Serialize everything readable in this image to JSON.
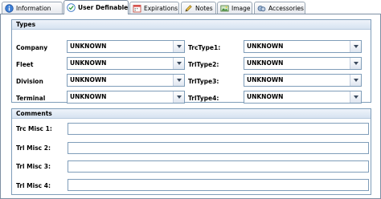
{
  "tabs": [
    {
      "label": "Information",
      "icon": "info-icon"
    },
    {
      "label": "User Definables",
      "icon": "user-definables-icon",
      "active": true
    },
    {
      "label": "Expirations",
      "icon": "calendar-icon"
    },
    {
      "label": "Notes",
      "icon": "pencil-icon"
    },
    {
      "label": "Image",
      "icon": "image-icon"
    },
    {
      "label": "Accessories",
      "icon": "accessories-icon"
    }
  ],
  "types": {
    "title": "Types",
    "fields": [
      {
        "label": "Company",
        "value": "UNKNOWN"
      },
      {
        "label": "Fleet",
        "value": "UNKNOWN"
      },
      {
        "label": "Division",
        "value": "UNKNOWN"
      },
      {
        "label": "Terminal",
        "value": "UNKNOWN"
      },
      {
        "label": "TrcType1:",
        "value": "UNKNOWN"
      },
      {
        "label": "TrlType2:",
        "value": "UNKNOWN"
      },
      {
        "label": "TrlType3:",
        "value": "UNKNOWN"
      },
      {
        "label": "TrlType4:",
        "value": "UNKNOWN"
      }
    ]
  },
  "comments": {
    "title": "Comments",
    "fields": [
      {
        "label": "Trc Misc 1:",
        "value": ""
      },
      {
        "label": "Trl Misc 2:",
        "value": ""
      },
      {
        "label": "Trl Misc 3:",
        "value": ""
      },
      {
        "label": "Trl Misc 4:",
        "value": ""
      }
    ]
  }
}
